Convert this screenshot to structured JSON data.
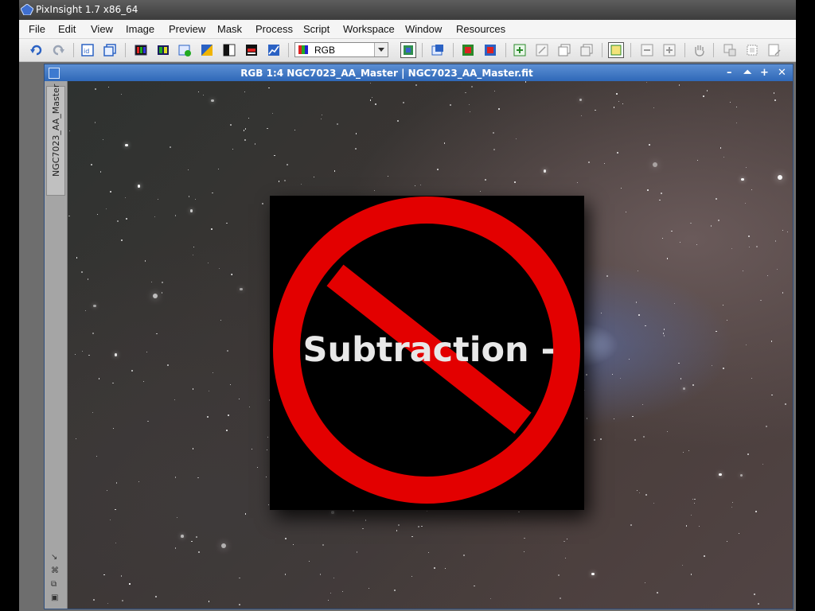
{
  "window": {
    "title": "PixInsight 1.7 x86_64"
  },
  "menu": [
    "File",
    "Edit",
    "View",
    "Image",
    "Preview",
    "Mask",
    "Process",
    "Script",
    "Workspace",
    "Window",
    "Resources"
  ],
  "toolbar": {
    "channel_value": "RGB"
  },
  "image_window": {
    "title": "RGB 1:4 NGC7023_AA_Master | NGC7023_AA_Master.fit",
    "side_tab_label": "NGC7023_AA_Master"
  },
  "overlay": {
    "text": "Subtraction -",
    "ring_color": "#e30000",
    "icon": "prohibited-sign-icon"
  }
}
